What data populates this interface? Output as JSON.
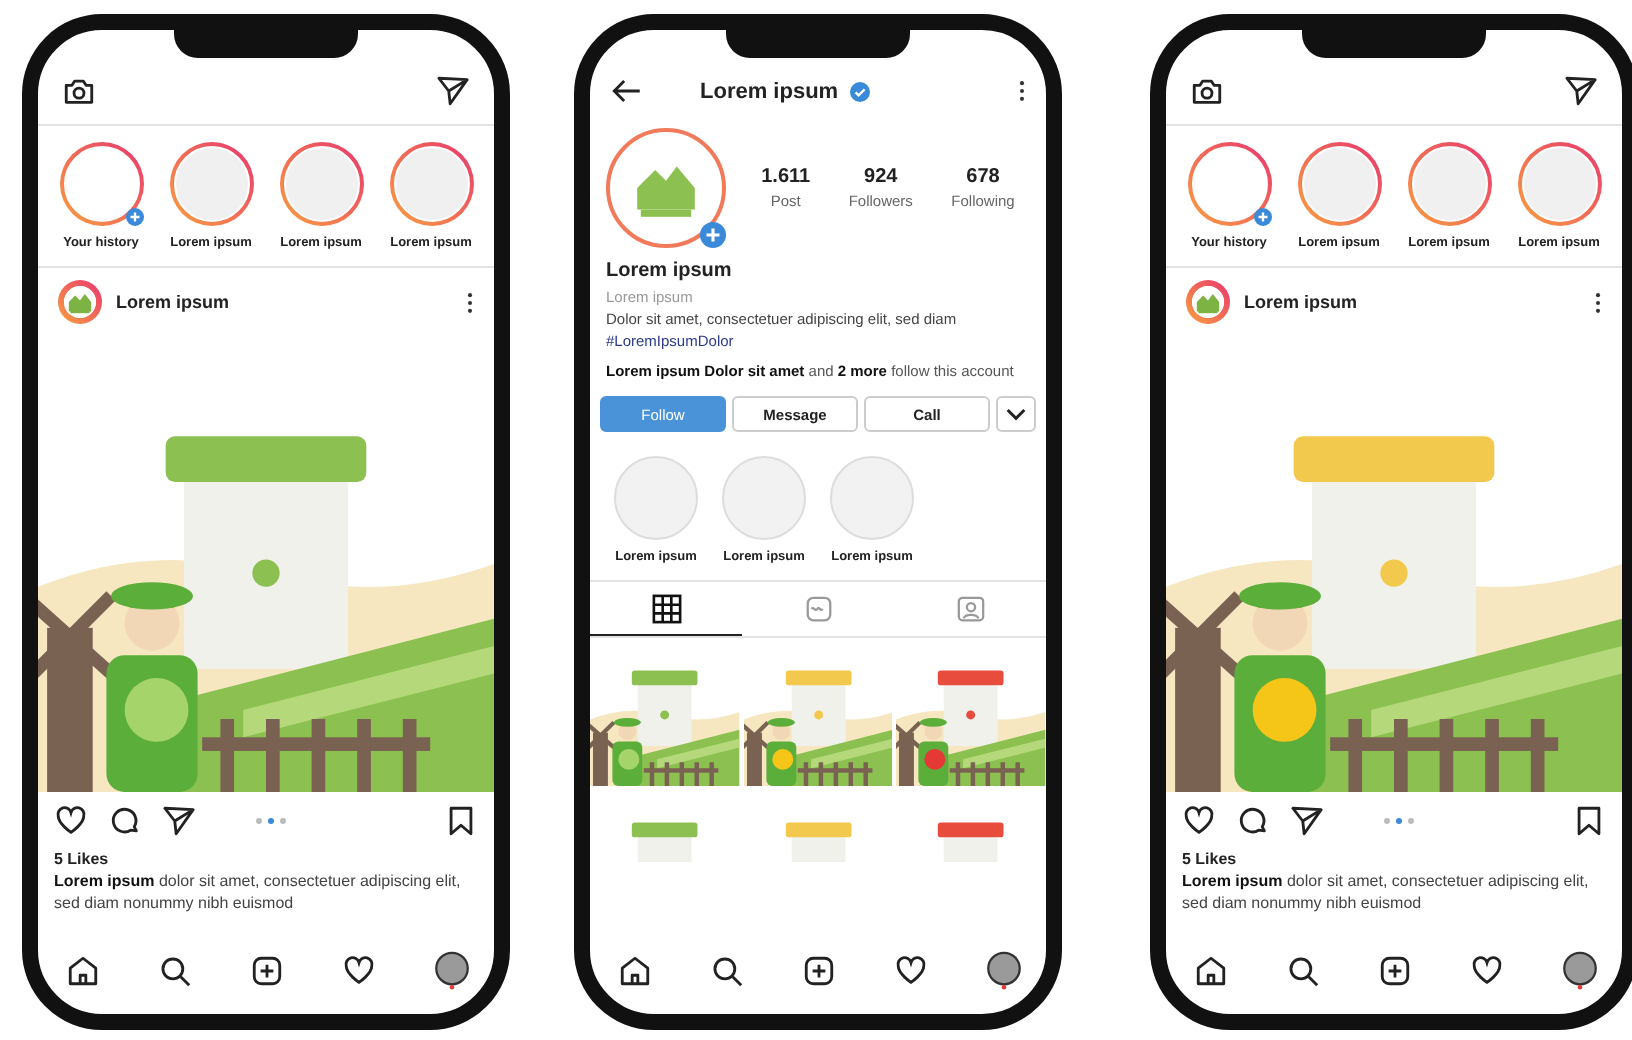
{
  "phones": [
    {
      "kind": "feed",
      "stories": [
        {
          "label": "Your history",
          "add": true
        },
        {
          "label": "Lorem ipsum",
          "add": false
        },
        {
          "label": "Lorem ipsum",
          "add": false
        },
        {
          "label": "Lorem ipsum",
          "add": false
        }
      ],
      "post": {
        "author": "Lorem ipsum",
        "image": {
          "kind": "picture"
        },
        "dots": [
          {
            "selected": false
          },
          {
            "selected": true
          },
          {
            "selected": false
          }
        ],
        "likes": "5 Likes",
        "caption": "**Lorem ipsum** dolor sit amet, consectetuer adipiscing elit, sed diam nonummy nibh euismod"
      }
    },
    {
      "kind": "profile",
      "title": "Lorem ipsum",
      "verified": true,
      "stats": [
        {
          "value": "1.611",
          "label": "Post"
        },
        {
          "value": "924",
          "label": "Followers"
        },
        {
          "value": "678",
          "label": "Following"
        }
      ],
      "name": "Lorem ipsum",
      "category": "Lorem ipsum",
      "bio": "Dolor sit amet, consectetuer adipiscing elit, sed diam",
      "hashtag": "#LoremIpsumDolor",
      "followed_by": "**Lorem ipsum Dolor sit amet** and **2 more** follow this account",
      "buttons": [
        {
          "label": "Follow",
          "kind": "primary"
        },
        {
          "label": "Message",
          "kind": "plain"
        },
        {
          "label": "Call",
          "kind": "plain"
        }
      ],
      "highlights": [
        {
          "label": "Lorem ipsum"
        },
        {
          "label": "Lorem ipsum"
        },
        {
          "label": "Lorem ipsum"
        }
      ],
      "tabs": [
        {
          "kind": "grid",
          "selected": true
        },
        {
          "kind": "reels",
          "selected": false
        },
        {
          "kind": "tagged",
          "selected": false
        }
      ],
      "grid": [
        {
          "kind": "picture"
        },
        {
          "kind": "picture"
        },
        {
          "kind": "picture"
        },
        {
          "kind": "picture"
        },
        {
          "kind": "picture"
        },
        {
          "kind": "picture"
        }
      ]
    },
    {
      "kind": "feed",
      "stories": [
        {
          "label": "Your history",
          "add": true
        },
        {
          "label": "Lorem ipsum",
          "add": false
        },
        {
          "label": "Lorem ipsum",
          "add": false
        },
        {
          "label": "Lorem ipsum",
          "add": false
        }
      ],
      "post": {
        "author": "Lorem ipsum",
        "image": {
          "kind": "picture"
        },
        "dots": [
          {
            "selected": false
          },
          {
            "selected": true
          },
          {
            "selected": false
          }
        ],
        "likes": "5 Likes",
        "caption": "**Lorem ipsum** dolor sit amet, consectetuer adipiscing elit, sed diam nonummy nibh euismod"
      }
    }
  ]
}
